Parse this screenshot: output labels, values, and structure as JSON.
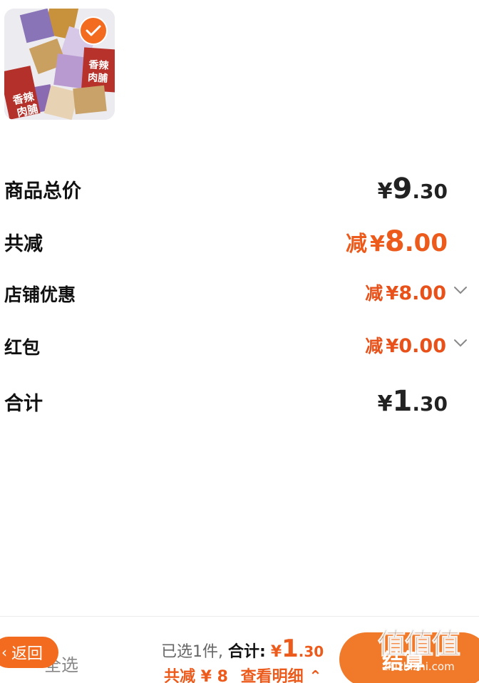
{
  "product": {
    "image_alt": "香辣肉脯",
    "image_text": "香辣肉脯",
    "selected": true,
    "check_icon": "checkmark-icon",
    "check_color": "#f26b1f"
  },
  "rows": {
    "goods_total": {
      "label": "商品总价",
      "currency": "¥",
      "int": "9",
      "dec": ".30"
    },
    "total_reduction": {
      "label": "共减",
      "prefix": "减",
      "currency": "¥",
      "int": "8",
      "dec": ".00"
    },
    "shop_discount": {
      "label": "店铺优惠",
      "prefix": "减",
      "currency": "¥",
      "int": "8",
      "dec": ".00",
      "icon": "chevron-down-icon"
    },
    "red_packet": {
      "label": "红包",
      "prefix": "减",
      "currency": "¥",
      "int": "0",
      "dec": ".00",
      "icon": "chevron-down-icon"
    },
    "grand_total": {
      "label": "合计",
      "currency": "¥",
      "int": "1",
      "dec": ".30"
    }
  },
  "bottom_bar": {
    "back_label": "返回",
    "back_icon": "chevron-left-icon",
    "select_all_label": "全选",
    "selected_text": "已选1件,",
    "total_label": "合计:",
    "total_currency": "¥",
    "total_int": "1",
    "total_dec": ".30",
    "reduction_text": "共减 ¥ 8",
    "detail_label": "查看明细",
    "detail_icon": "chevron-up-icon",
    "checkout_label": "结算"
  },
  "watermark": {
    "logo": "值值值",
    "text": "zhizhizhi.com"
  },
  "colors": {
    "accent": "#ec5b1c",
    "button": "#f07a2a",
    "text": "#111111"
  }
}
